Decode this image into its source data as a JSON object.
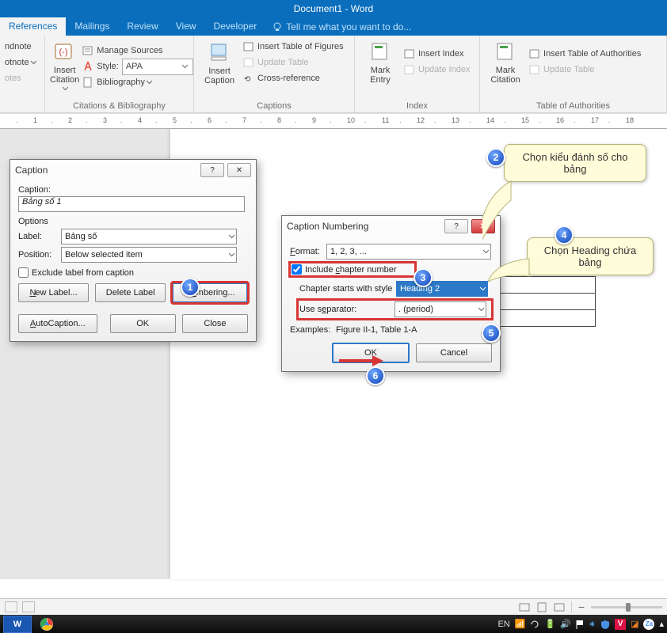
{
  "window": {
    "title": "Document1 - Word"
  },
  "tabs": [
    "References",
    "Mailings",
    "Review",
    "View",
    "Developer"
  ],
  "tellme": "Tell me what you want to do...",
  "ribbon": {
    "footnotes": {
      "endnote": "ndnote",
      "footnote": "otnote",
      "showNotes": "otes",
      "groupLabel": ""
    },
    "citations": {
      "insertCitation": "Insert Citation",
      "manageSources": "Manage Sources",
      "styleLabel": "Style:",
      "styleValue": "APA",
      "bibliography": "Bibliography",
      "groupLabel": "Citations & Bibliography"
    },
    "captions": {
      "insertCaption": "Insert Caption",
      "insertTableOfFigures": "Insert Table of Figures",
      "updateTable": "Update Table",
      "crossReference": "Cross-reference",
      "groupLabel": "Captions"
    },
    "index": {
      "markEntry": "Mark Entry",
      "insertIndex": "Insert Index",
      "updateIndex": "Update Index",
      "groupLabel": "Index"
    },
    "toa": {
      "markCitation": "Mark Citation",
      "insertTOA": "Insert Table of Authorities",
      "updateTable": "Update Table",
      "groupLabel": "Table of Authorities"
    }
  },
  "dialogCaption": {
    "title": "Caption",
    "captionLabel": "Caption:",
    "captionValue": "Bảng số 1",
    "optionsLabel": "Options",
    "labelLabel": "Label:",
    "labelValue": "Bảng số",
    "positionLabel": "Position:",
    "positionValue": "Below selected item",
    "excludeLabel": "Exclude label from caption",
    "newLabel": "New Label...",
    "deleteLabel": "Delete Label",
    "numbering": "Numbering...",
    "autoCaption": "AutoCaption...",
    "ok": "OK",
    "close": "Close"
  },
  "dialogNumbering": {
    "title": "Caption Numbering",
    "formatLabel": "Format:",
    "formatValue": "1, 2, 3, ...",
    "includeChapter": "Include chapter number",
    "chapterStarts": "Chapter starts with style",
    "chapterValue": "Heading 2",
    "separatorLabel": "Use separator:",
    "separatorValue": ".    (period)",
    "examplesLabel": "Examples:",
    "examplesValue": "Figure II-1, Table 1-A",
    "ok": "OK",
    "cancel": "Cancel"
  },
  "callouts": {
    "c2": "Chọn kiểu đánh số cho bảng",
    "c4": "Chọn Heading chứa bảng"
  },
  "steps": {
    "1": "1",
    "2": "2",
    "3": "3",
    "4": "4",
    "5": "5",
    "6": "6"
  },
  "statusbar": {
    "lang": "EN"
  },
  "ruler": [
    ".",
    "1",
    ".",
    "2",
    ".",
    "3",
    ".",
    "4",
    ".",
    "5",
    ".",
    "6",
    ".",
    "7",
    ".",
    "8",
    ".",
    "9",
    ".",
    "10",
    ".",
    "11",
    ".",
    "12",
    ".",
    "13",
    ".",
    "14",
    ".",
    "15",
    ".",
    "16",
    ".",
    "17",
    ".",
    "18"
  ]
}
